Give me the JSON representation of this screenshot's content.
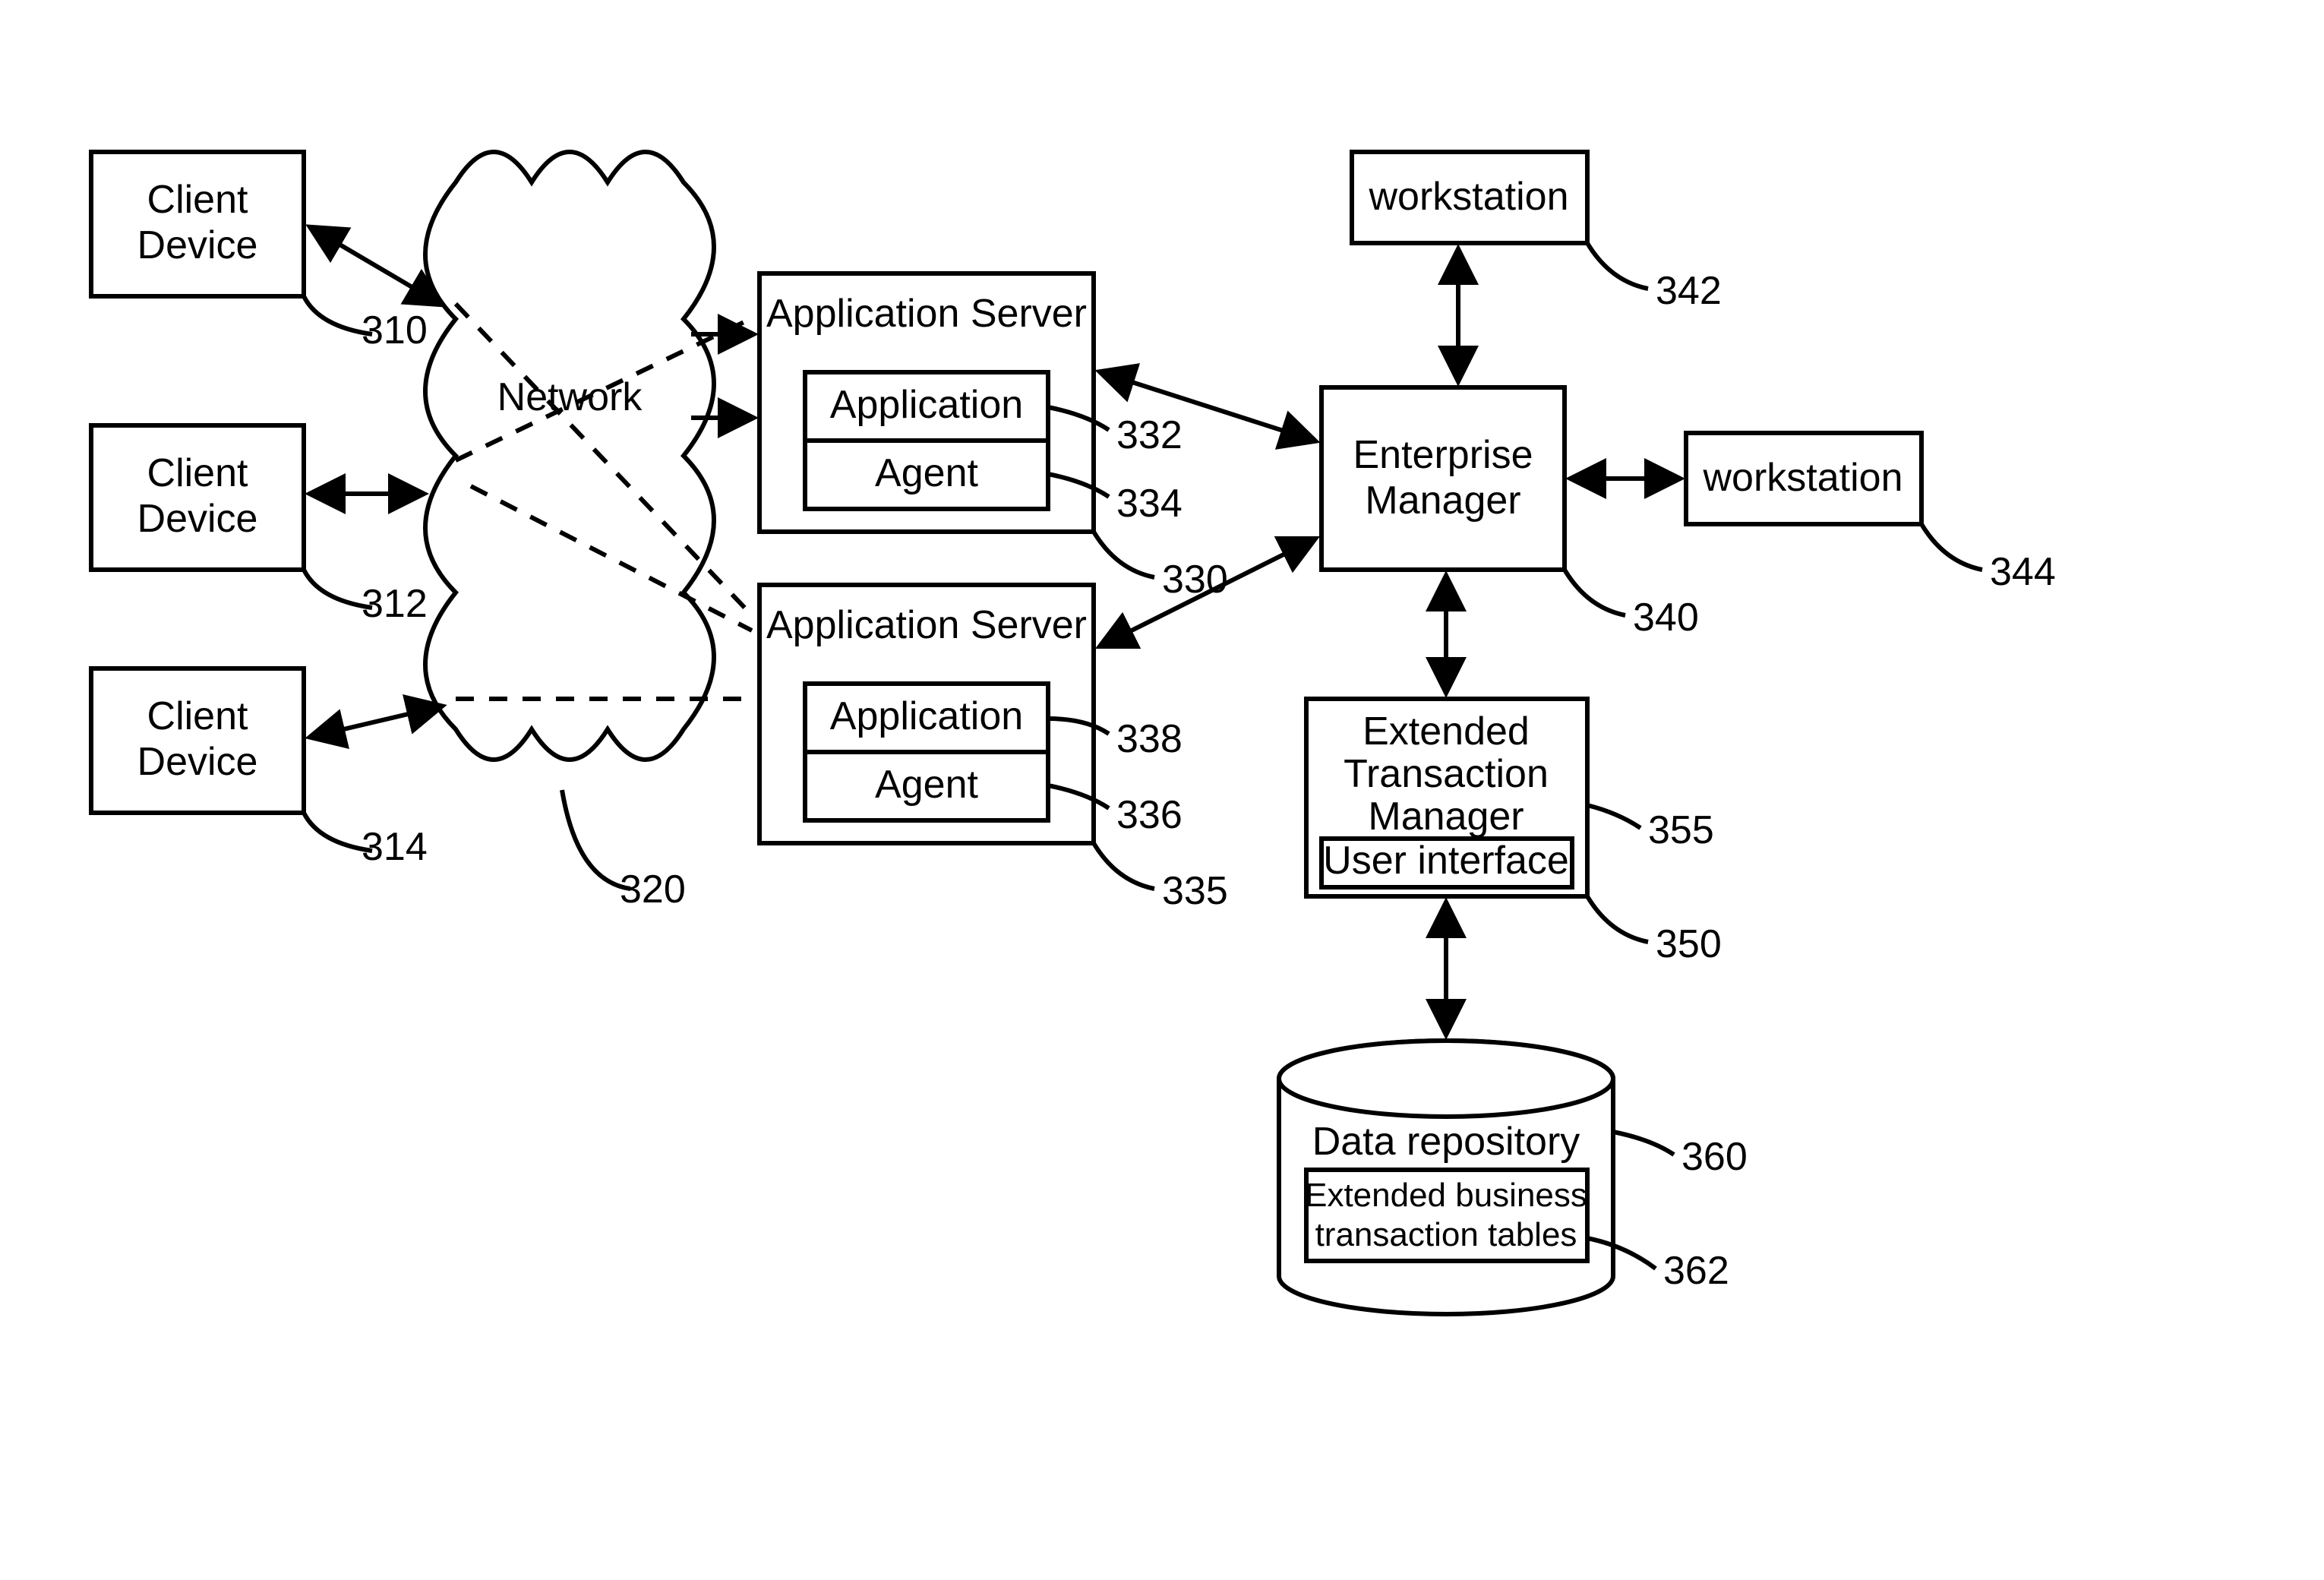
{
  "nodes": {
    "client1": {
      "label": "Client Device",
      "ref": "310"
    },
    "client2": {
      "label": "Client Device",
      "ref": "312"
    },
    "client3": {
      "label": "Client Device",
      "ref": "314"
    },
    "network": {
      "label": "Network",
      "ref": "320"
    },
    "appserv1": {
      "label": "Application Server",
      "ref": "330"
    },
    "app1": {
      "label": "Application",
      "ref": "332"
    },
    "agent1": {
      "label": "Agent",
      "ref": "334"
    },
    "appserv2": {
      "label": "Application Server",
      "ref": "335"
    },
    "app2": {
      "label": "Application",
      "ref": "338"
    },
    "agent2": {
      "label": "Agent",
      "ref": "336"
    },
    "entmgr": {
      "label": "Enterprise Manager",
      "ref": "340"
    },
    "ws1": {
      "label": "workstation",
      "ref": "342"
    },
    "ws2": {
      "label": "workstation",
      "ref": "344"
    },
    "etm": {
      "label": "Extended Transaction Manager",
      "ref": "350"
    },
    "ui": {
      "label": "User interface",
      "ref": "355"
    },
    "repo": {
      "label": "Data repository",
      "ref": "360"
    },
    "tables": {
      "label": "Extended business transaction tables",
      "ref": "362"
    }
  }
}
